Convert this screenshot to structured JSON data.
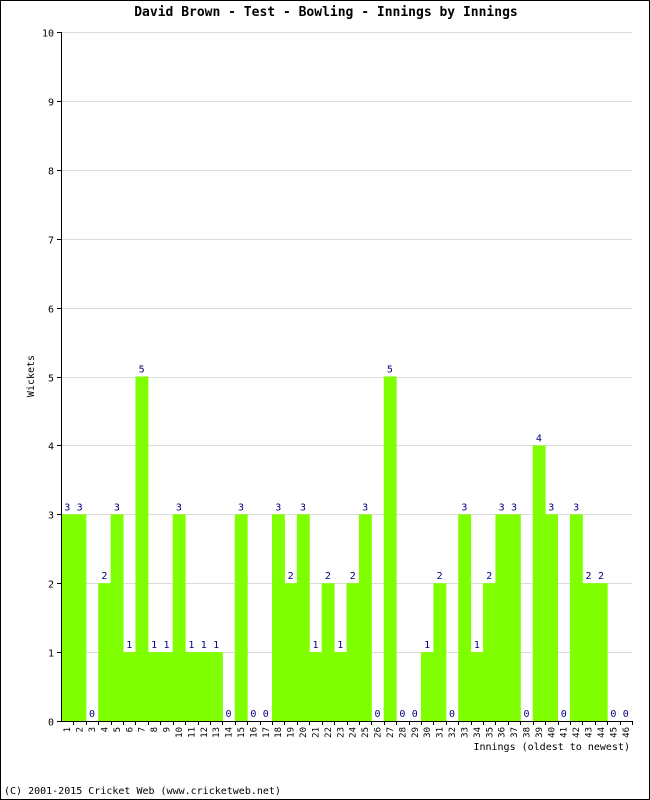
{
  "chart_data": {
    "type": "bar",
    "title": "David Brown - Test - Bowling - Innings by Innings",
    "xlabel": "Innings (oldest to newest)",
    "ylabel": "Wickets",
    "ylim": [
      0,
      10
    ],
    "yticks": [
      0,
      1,
      2,
      3,
      4,
      5,
      6,
      7,
      8,
      9,
      10
    ],
    "grid": true,
    "bar_color": "#80ff00",
    "label_color": "#000080",
    "categories": [
      "1",
      "2",
      "3",
      "4",
      "5",
      "6",
      "7",
      "8",
      "9",
      "10",
      "11",
      "12",
      "13",
      "14",
      "15",
      "16",
      "17",
      "18",
      "19",
      "20",
      "21",
      "22",
      "23",
      "24",
      "25",
      "26",
      "27",
      "28",
      "29",
      "30",
      "31",
      "32",
      "33",
      "34",
      "35",
      "36",
      "37",
      "38",
      "39",
      "40",
      "41",
      "42",
      "43",
      "44",
      "45",
      "46"
    ],
    "values": [
      3,
      3,
      0,
      2,
      3,
      1,
      5,
      1,
      1,
      3,
      1,
      1,
      1,
      0,
      3,
      0,
      0,
      3,
      2,
      3,
      1,
      2,
      1,
      2,
      3,
      0,
      5,
      0,
      0,
      1,
      2,
      0,
      3,
      1,
      2,
      3,
      3,
      0,
      4,
      3,
      0,
      3,
      2,
      2,
      0,
      0
    ]
  },
  "footer": "(C) 2001-2015 Cricket Web (www.cricketweb.net)"
}
